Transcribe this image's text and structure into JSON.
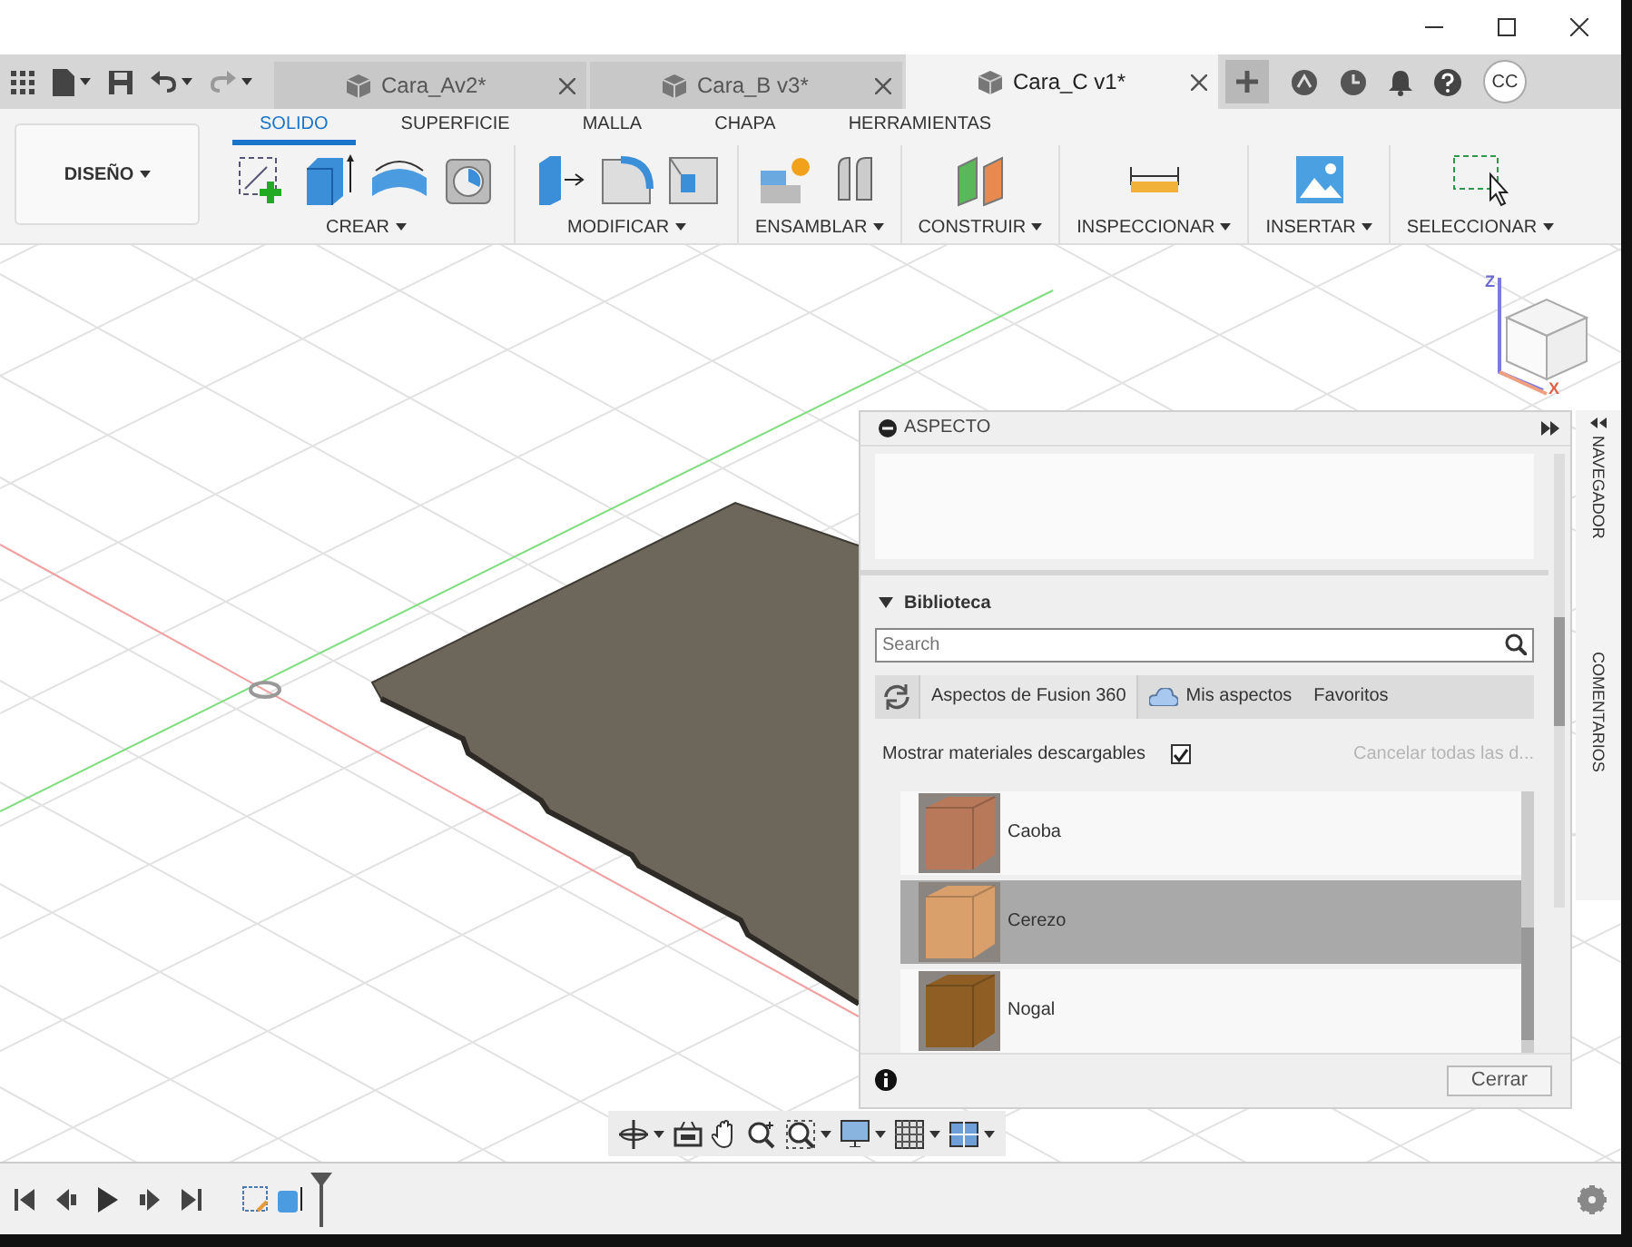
{
  "document_tabs": [
    {
      "label": "Cara_Av2*",
      "selected": false
    },
    {
      "label": "Cara_B v3*",
      "selected": false
    },
    {
      "label": "Cara_C v1*",
      "selected": true
    }
  ],
  "user": {
    "initials": "CC"
  },
  "workspace": {
    "label": "DISEÑO"
  },
  "ribbon_tabs": [
    {
      "label": "SOLIDO",
      "selected": true
    },
    {
      "label": "SUPERFICIE",
      "selected": false
    },
    {
      "label": "MALLA",
      "selected": false
    },
    {
      "label": "CHAPA",
      "selected": false
    },
    {
      "label": "HERRAMIENTAS",
      "selected": false
    }
  ],
  "ribbon_groups": [
    {
      "label": "CREAR"
    },
    {
      "label": "MODIFICAR"
    },
    {
      "label": "ENSAMBLAR"
    },
    {
      "label": "CONSTRUIR"
    },
    {
      "label": "INSPECCIONAR"
    },
    {
      "label": "INSERTAR"
    },
    {
      "label": "SELECCIONAR"
    }
  ],
  "viewcube": {
    "axes": [
      "Z",
      "X"
    ]
  },
  "panel": {
    "title": "ASPECTO",
    "section": {
      "label": "Biblioteca",
      "expanded": true
    },
    "search": {
      "placeholder": "Search"
    },
    "library_tabs": [
      {
        "label": "Aspectos de Fusion 360",
        "selected": true
      },
      {
        "label": "Mis aspectos",
        "selected": false
      },
      {
        "label": "Favoritos",
        "selected": false
      }
    ],
    "show_downloadable": {
      "label": "Mostrar materiales descargables",
      "checked": true
    },
    "cancel_link": {
      "label": "Cancelar todas las d...",
      "disabled": true
    },
    "materials": [
      {
        "name": "Caoba",
        "selected": false,
        "color": "#b8795a"
      },
      {
        "name": "Cerezo",
        "selected": true,
        "color": "#d9a06c"
      },
      {
        "name": "Nogal",
        "selected": false,
        "color": "#8e5e24"
      }
    ],
    "close_button": "Cerrar"
  },
  "side_tabs": [
    "NAVEGADOR",
    "COMENTARIOS"
  ]
}
